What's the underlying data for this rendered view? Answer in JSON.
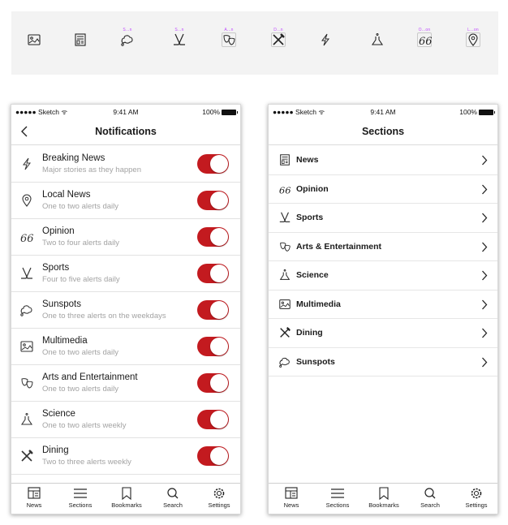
{
  "icon_strip": {
    "tags": [
      "",
      "",
      "S...n",
      "S...n",
      "A...n",
      "D...n",
      "",
      "",
      "O...on",
      "L...on"
    ],
    "icons": [
      "multimedia-icon",
      "news-icon",
      "sunspots-icon",
      "sports-icon",
      "arts-icon",
      "dining-icon",
      "breaking-news-icon",
      "science-icon",
      "opinion-icon",
      "local-news-icon"
    ]
  },
  "status_bar": {
    "carrier": "●●●●● Sketch ᯤ",
    "time": "9:41 AM",
    "battery": "100%"
  },
  "notifications": {
    "title": "Notifications",
    "rows": [
      {
        "label": "Breaking News",
        "sub": "Major stories as they happen",
        "icon": "breaking-news-icon",
        "on": true
      },
      {
        "label": "Local News",
        "sub": "One to two alerts daily",
        "icon": "local-news-icon",
        "on": true
      },
      {
        "label": "Opinion",
        "sub": "Two to four alerts daily",
        "icon": "opinion-icon",
        "on": true
      },
      {
        "label": "Sports",
        "sub": "Four to five alerts daily",
        "icon": "sports-icon",
        "on": true
      },
      {
        "label": "Sunspots",
        "sub": "One to three alerts on the weekdays",
        "icon": "sunspots-icon",
        "on": true
      },
      {
        "label": "Multimedia",
        "sub": "One to two alerts daily",
        "icon": "multimedia-icon",
        "on": true
      },
      {
        "label": "Arts and Entertainment",
        "sub": "One to two alerts daily",
        "icon": "arts-icon",
        "on": true
      },
      {
        "label": "Science",
        "sub": "One to two alerts weekly",
        "icon": "science-icon",
        "on": true
      },
      {
        "label": "Dining",
        "sub": "Two to three alerts weekly",
        "icon": "dining-icon",
        "on": true
      }
    ]
  },
  "sections": {
    "title": "Sections",
    "rows": [
      {
        "label": "News",
        "icon": "news-icon"
      },
      {
        "label": "Opinion",
        "icon": "opinion-icon"
      },
      {
        "label": "Sports",
        "icon": "sports-icon"
      },
      {
        "label": "Arts & Entertainment",
        "icon": "arts-icon"
      },
      {
        "label": "Science",
        "icon": "science-icon"
      },
      {
        "label": "Multimedia",
        "icon": "multimedia-icon"
      },
      {
        "label": "Dining",
        "icon": "dining-icon"
      },
      {
        "label": "Sunspots",
        "icon": "sunspots-icon"
      }
    ]
  },
  "tab_bar": [
    {
      "label": "News",
      "icon": "news-tab-icon"
    },
    {
      "label": "Sections",
      "icon": "menu-icon"
    },
    {
      "label": "Bookmarks",
      "icon": "bookmark-icon"
    },
    {
      "label": "Search",
      "icon": "search-icon"
    },
    {
      "label": "Settings",
      "icon": "gear-icon"
    }
  ],
  "colors": {
    "toggle_on": "#c31a1f",
    "subtitle_gray": "#a3a3a3",
    "tag_purple": "#c04cff",
    "strip_bg": "#f3f3f3"
  }
}
